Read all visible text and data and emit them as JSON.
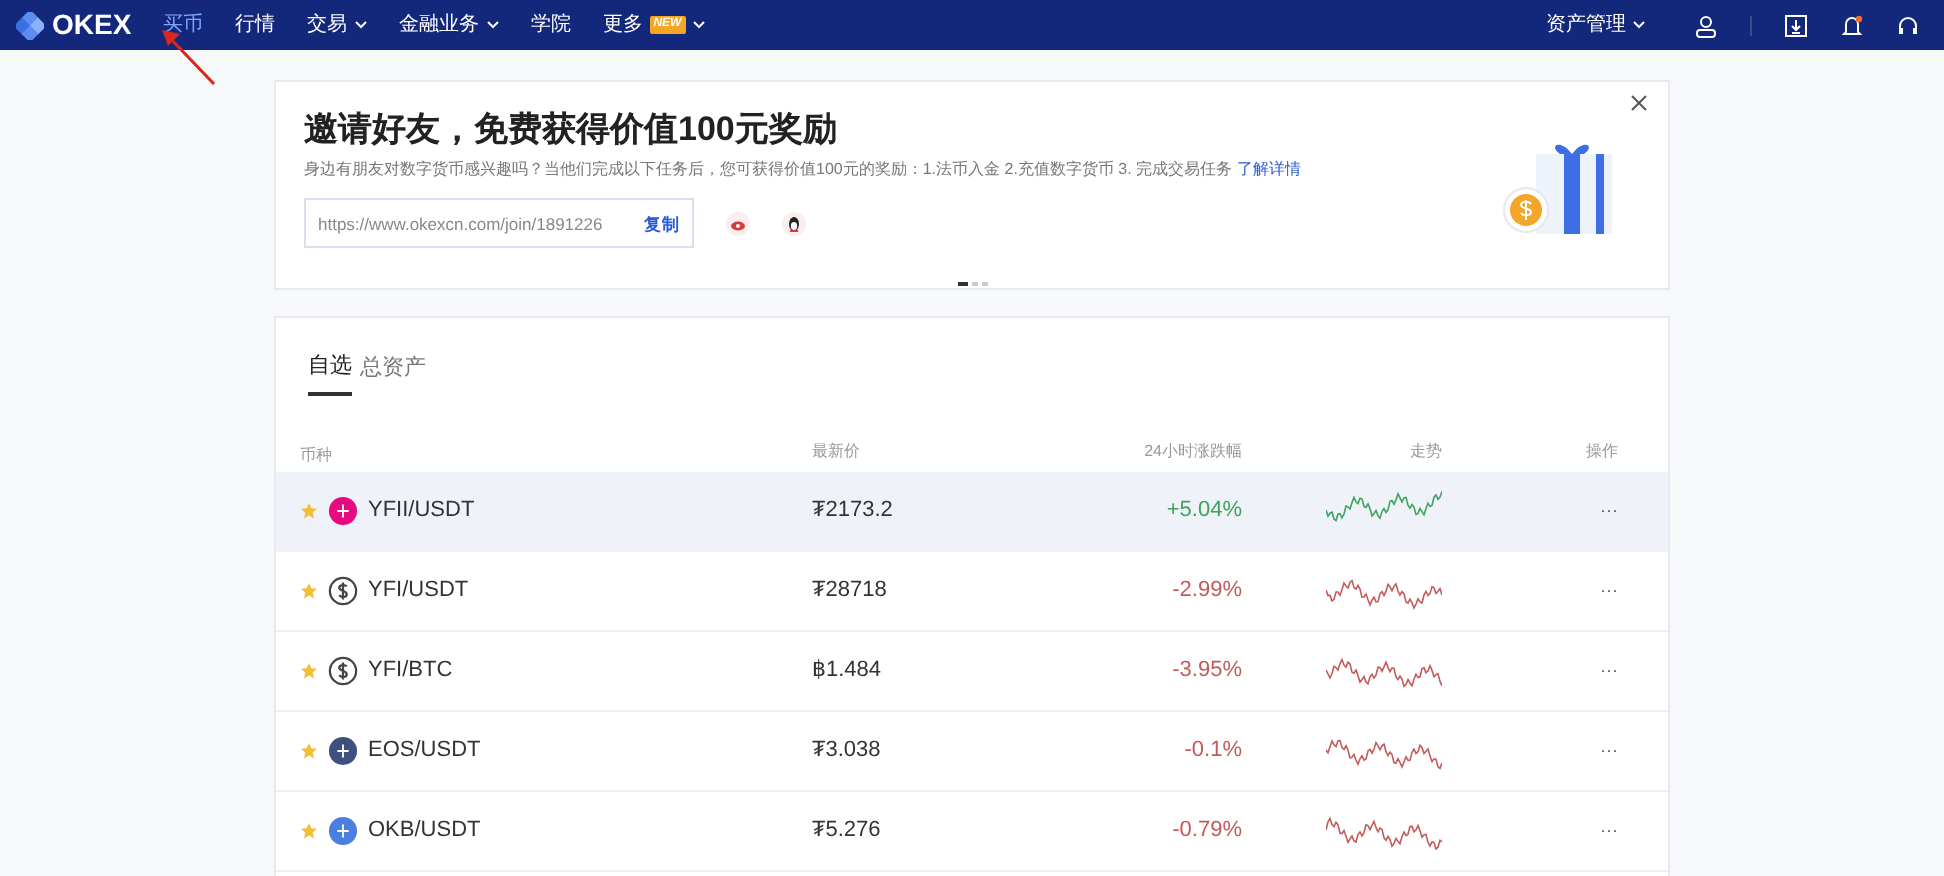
{
  "navbar": {
    "logo": "OKEX",
    "items": [
      {
        "label": "买币",
        "dropdown": false
      },
      {
        "label": "行情",
        "dropdown": false
      },
      {
        "label": "交易",
        "dropdown": true
      },
      {
        "label": "金融业务",
        "dropdown": true
      },
      {
        "label": "学院",
        "dropdown": false
      },
      {
        "label": "更多",
        "dropdown": true,
        "badge": "NEW"
      }
    ],
    "right_menu": {
      "label": "资产管理",
      "dropdown": true
    },
    "notification_dot": true
  },
  "invite_banner": {
    "title": "邀请好友，免费获得价值100元奖励",
    "description": "身边有朋友对数字货币感兴趣吗？当他们完成以下任务后，您可获得价值100元的奖励：1.法币入金 2.充值数字货币 3. 完成交易任务",
    "details_link": "了解详情",
    "invite_link": "https://www.okexcn.com/join/1891226",
    "copy_button": "复制",
    "carousel_dots": [
      {
        "selected": true
      },
      {
        "selected": false
      },
      {
        "selected": false
      }
    ]
  },
  "watchlist": {
    "tabs": [
      {
        "label": "自选",
        "selected": true
      },
      {
        "label": "总资产",
        "selected": false
      }
    ],
    "columns": [
      "币种",
      "最新价",
      "24小时涨跌幅",
      "走势",
      "操作"
    ],
    "rows": [
      {
        "pair": "YFII/USDT",
        "price": "₮2173.2",
        "change": "+5.04%",
        "rising": true,
        "starred": true,
        "selected": true,
        "kind": "filled",
        "color": "#e6097f",
        "actions": "···"
      },
      {
        "pair": "YFI/USDT",
        "price": "₮28718",
        "change": "-2.99%",
        "rising": false,
        "starred": true,
        "selected": false,
        "kind": "outline",
        "color": "#444444",
        "actions": "···"
      },
      {
        "pair": "YFI/BTC",
        "price": "฿1.484",
        "change": "-3.95%",
        "rising": false,
        "starred": true,
        "selected": false,
        "kind": "outline",
        "color": "#444444",
        "actions": "···"
      },
      {
        "pair": "EOS/USDT",
        "price": "₮3.038",
        "change": "-0.1%",
        "rising": false,
        "starred": true,
        "selected": false,
        "kind": "filled",
        "color": "#3f4f80",
        "actions": "···"
      },
      {
        "pair": "OKB/USDT",
        "price": "₮5.276",
        "change": "-0.79%",
        "rising": false,
        "starred": true,
        "selected": false,
        "kind": "filled",
        "color": "#4a7ee0",
        "actions": "···"
      }
    ]
  }
}
